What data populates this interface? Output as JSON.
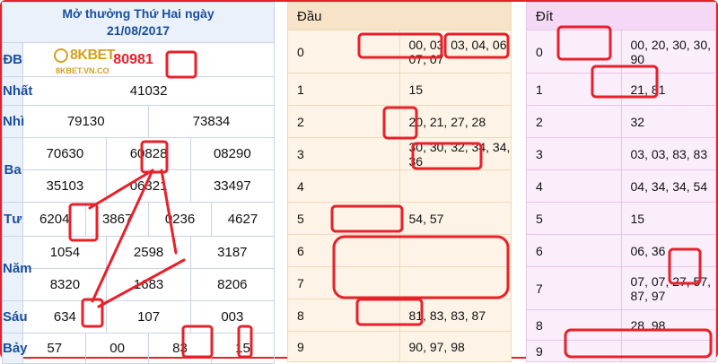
{
  "header": {
    "line1": "Mở thưởng Thứ Hai ngày",
    "line2": "21/08/2017"
  },
  "logo": {
    "brand": "8KBET",
    "url": "8KBET.VN.CO"
  },
  "prizes": {
    "db": {
      "label": "ĐB",
      "value": "80981"
    },
    "nhat": {
      "label": "Nhất",
      "values": [
        "41032"
      ]
    },
    "nhi": {
      "label": "Nhì",
      "values": [
        "79130",
        "73834"
      ]
    },
    "ba": {
      "label": "Ba",
      "values": [
        "70630",
        "60828",
        "08290",
        "35103",
        "06321",
        "33497"
      ]
    },
    "tu": {
      "label": "Tư",
      "values": [
        "6204",
        "3867",
        "0236",
        "4627"
      ]
    },
    "nam": {
      "label": "Năm",
      "values": [
        "1054",
        "2598",
        "3187",
        "8320",
        "1683",
        "8206"
      ]
    },
    "sau": {
      "label": "Sáu",
      "values": "634,107,003"
    },
    "bay": {
      "label": "Bảy",
      "values": [
        "57",
        "00",
        "83",
        "15"
      ]
    }
  },
  "dau": {
    "header": "Đầu",
    "rows": [
      {
        "k": "0",
        "v": "00, 03, 03, 04, 06, 07, 07"
      },
      {
        "k": "1",
        "v": "15"
      },
      {
        "k": "2",
        "v": "20, 21, 27, 28"
      },
      {
        "k": "3",
        "v": "30, 30, 32, 34, 34, 36"
      },
      {
        "k": "4",
        "v": ""
      },
      {
        "k": "5",
        "v": "54, 57"
      },
      {
        "k": "6",
        "v": ""
      },
      {
        "k": "7",
        "v": ""
      },
      {
        "k": "8",
        "v": "81, 83, 83, 87"
      },
      {
        "k": "9",
        "v": "90, 97, 98"
      }
    ]
  },
  "dit": {
    "header": "Đít",
    "rows": [
      {
        "k": "0",
        "v": "00, 20, 30, 30, 90"
      },
      {
        "k": "1",
        "v": "21, 81"
      },
      {
        "k": "2",
        "v": "32"
      },
      {
        "k": "3",
        "v": "03, 03, 83, 83"
      },
      {
        "k": "4",
        "v": "04, 34, 34, 54"
      },
      {
        "k": "5",
        "v": "15"
      },
      {
        "k": "6",
        "v": "06, 36"
      },
      {
        "k": "7",
        "v": "07, 07, 27, 57, 87, 97"
      },
      {
        "k": "8",
        "v": "28, 98"
      },
      {
        "k": "9",
        "v": ""
      }
    ]
  },
  "colors": {
    "annotation": "#e8202a",
    "header_blue": "#1b4f9e",
    "logo_gold": "#d4a020"
  }
}
